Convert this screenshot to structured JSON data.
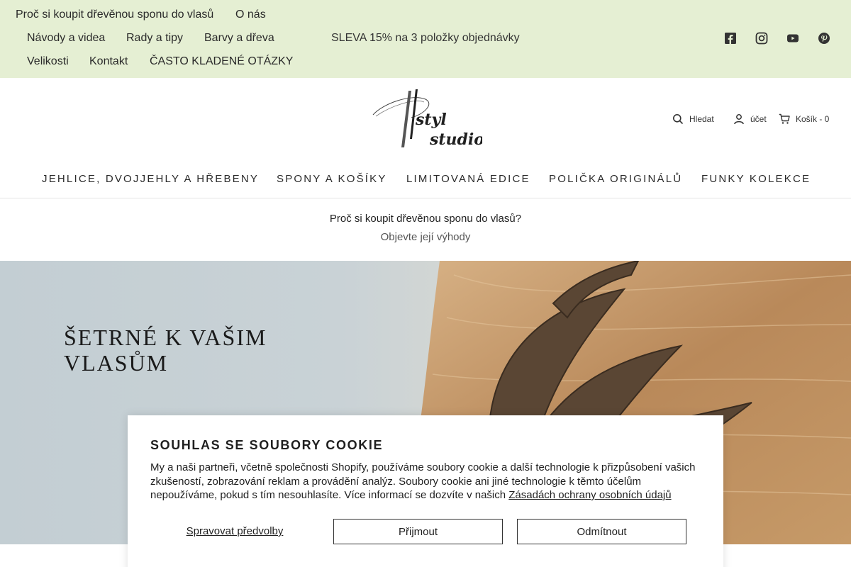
{
  "topbar": {
    "links": [
      "Proč si koupit dřevěnou sponu do vlasů",
      "O nás",
      "Návody a videa",
      "Rady a tipy",
      "Barvy a dřeva",
      "Velikosti",
      "Kontakt",
      "ČASTO KLADENÉ OTÁZKY"
    ],
    "promo": "SLEVA 15% na 3 položky objednávky",
    "social_icons": [
      "facebook-icon",
      "instagram-icon",
      "youtube-icon",
      "pinterest-icon"
    ]
  },
  "header": {
    "logo_text": [
      "styl",
      "studio"
    ],
    "search_label": "Hledat",
    "account_label": "účet",
    "cart_label": "Košík - 0"
  },
  "nav": {
    "items": [
      "JEHLICE, DVOJJEHLY A HŘEBENY",
      "SPONY A KOŠÍKY",
      "LIMITOVANÁ EDICE",
      "POLIČKA ORIGINÁLŮ",
      "FUNKY KOLEKCE"
    ]
  },
  "strip": {
    "title": "Proč si koupit dřevěnou sponu do vlasů?",
    "subtitle": "Objevte její výhody"
  },
  "hero": {
    "heading_line1": "ŠETRNÉ K VAŠIM",
    "heading_line2": "VLASŮM"
  },
  "cookie": {
    "title": "SOUHLAS SE SOUBORY COOKIE",
    "text": "My a naši partneři, včetně společnosti Shopify, používáme soubory cookie a další technologie k přizpůsobení vašich zkušeností, zobrazování reklam a provádění analýz. Soubory cookie ani jiné technologie k těmto účelům nepoužíváme, pokud s tím nesouhlasíte. Více informací se dozvíte v našich",
    "link": "Zásadách ochrany osobních údajů",
    "manage": "Spravovat předvolby",
    "accept": "Přijmout",
    "decline": "Odmítnout"
  },
  "colors": {
    "topbar_bg": "#e5efd3",
    "text": "#222222"
  }
}
